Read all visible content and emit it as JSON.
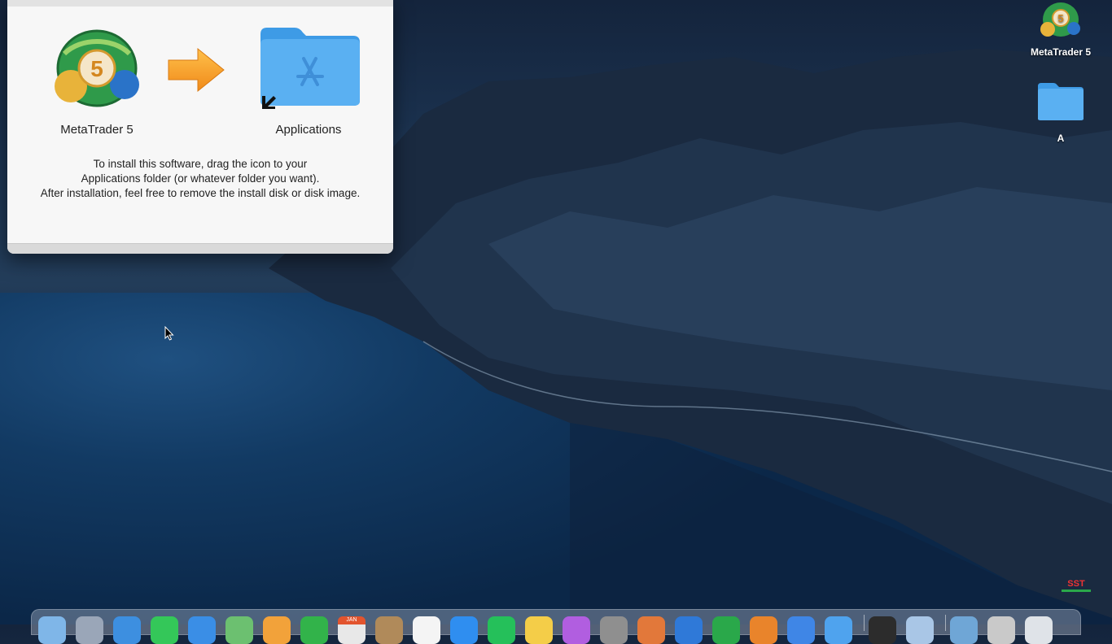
{
  "installer": {
    "app_label": "MetaTrader 5",
    "folder_label": "Applications",
    "instructions": [
      "To install this software, drag the icon to your",
      "Applications folder (or whatever folder you want).",
      "After installation, feel free to remove the install disk or disk image."
    ],
    "logo_number": "5"
  },
  "desktop": {
    "icons": [
      {
        "label": "MetaTrader 5",
        "icon": "metatrader-icon"
      },
      {
        "label": "A",
        "icon": "folder-icon"
      }
    ],
    "watermark": "SST"
  },
  "dock": {
    "apps": [
      {
        "icon": "finder-icon",
        "color": "#7fb6e8"
      },
      {
        "icon": "launchpad-icon",
        "color": "#9aa6b8"
      },
      {
        "icon": "safari-icon",
        "color": "#3d8fe0"
      },
      {
        "icon": "messages-icon",
        "color": "#34c759"
      },
      {
        "icon": "mail-icon",
        "color": "#3a8ee6"
      },
      {
        "icon": "maps-icon",
        "color": "#6cc070"
      },
      {
        "icon": "photos-icon",
        "color": "#f2a23a"
      },
      {
        "icon": "facetime-icon",
        "color": "#32b34a"
      },
      {
        "icon": "calendar-icon",
        "color": "#e8e8e8",
        "text": "JAN"
      },
      {
        "icon": "contacts-icon",
        "color": "#b08a5a"
      },
      {
        "icon": "reminders-icon",
        "color": "#f4f4f4"
      },
      {
        "icon": "app-store-icon",
        "color": "#2f8ef0"
      },
      {
        "icon": "whatsapp-icon",
        "color": "#25c05a"
      },
      {
        "icon": "notes-icon",
        "color": "#f4cd48"
      },
      {
        "icon": "podcasts-icon",
        "color": "#b15ee0"
      },
      {
        "icon": "system-preferences-icon",
        "color": "#8f8f8f"
      },
      {
        "icon": "books-icon",
        "color": "#e2783a"
      },
      {
        "icon": "xcode-icon",
        "color": "#2f79d8"
      },
      {
        "icon": "numbers-icon",
        "color": "#2aa84a"
      },
      {
        "icon": "pages-icon",
        "color": "#e9842b"
      },
      {
        "icon": "keynote-icon",
        "color": "#3f86e6"
      },
      {
        "icon": "mail-alt-icon",
        "color": "#4fa3ee"
      },
      {
        "icon": "terminal-icon",
        "color": "#2c2c2c"
      },
      {
        "icon": "preview-icon",
        "color": "#a9c6e6"
      },
      {
        "icon": "downloads-icon",
        "color": "#6fa6d6"
      },
      {
        "icon": "utility-icon",
        "color": "#c9c9c9"
      },
      {
        "icon": "trash-icon",
        "color": "#dfe3e8"
      }
    ]
  }
}
